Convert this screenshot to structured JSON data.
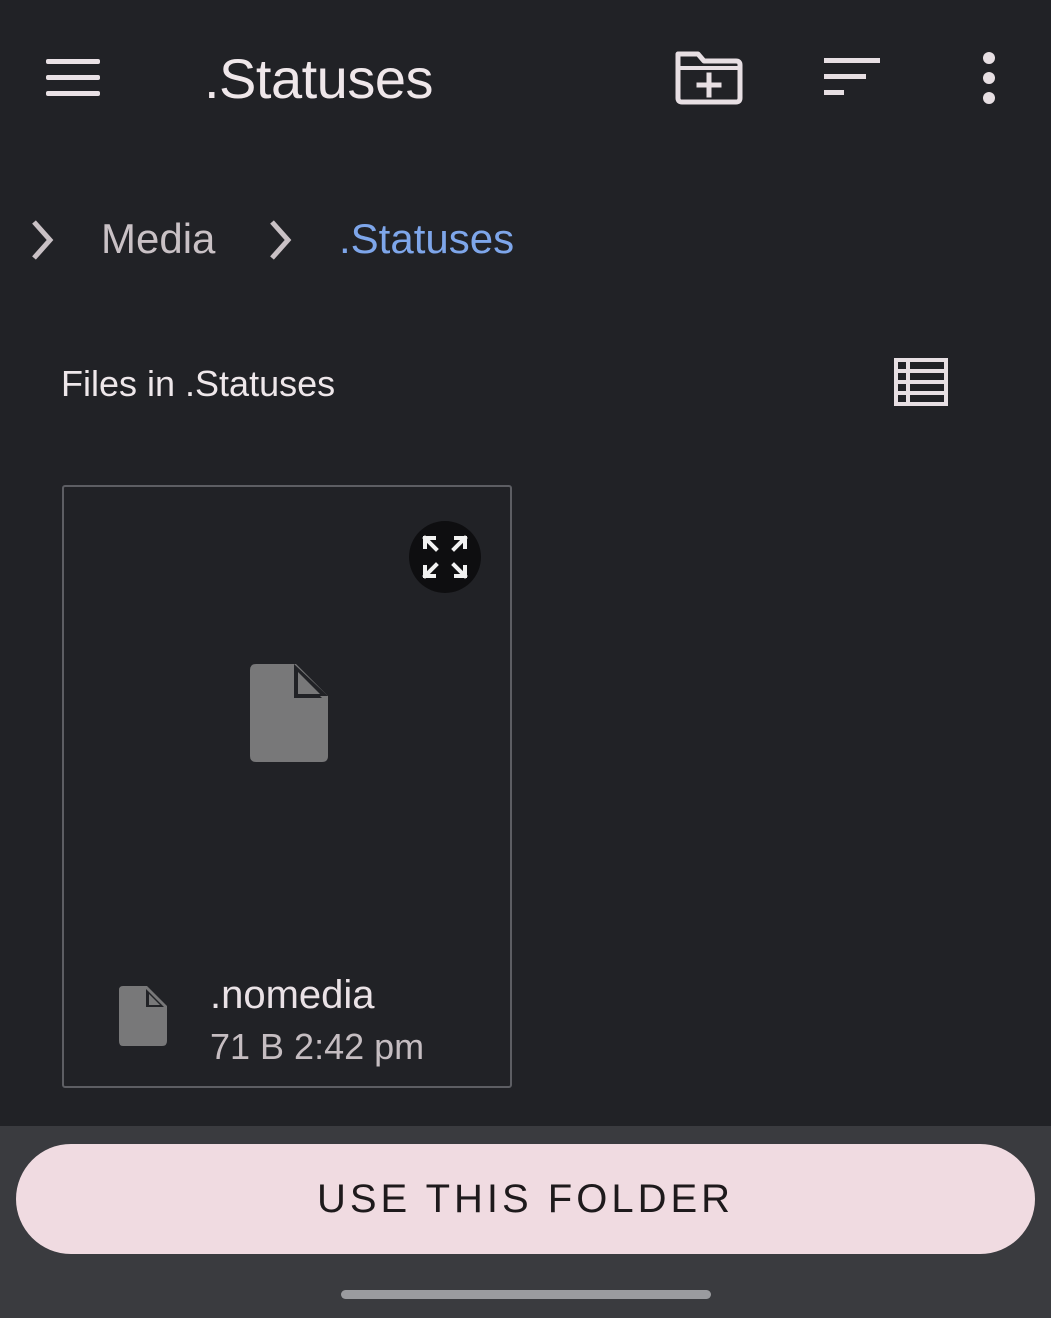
{
  "app_bar": {
    "title": ".Statuses",
    "menu_icon": "hamburger-menu-icon",
    "new_folder_icon": "create-new-folder-icon",
    "sort_icon": "sort-icon",
    "more_icon": "more-vertical-icon"
  },
  "breadcrumb": {
    "items": [
      {
        "label": "Media"
      },
      {
        "label": ".Statuses"
      }
    ],
    "separator_icon": "chevron-right-icon"
  },
  "section": {
    "title": "Files in .Statuses",
    "view_toggle_icon": "list-view-icon"
  },
  "files": [
    {
      "name": ".nomedia",
      "meta": "71 B 2:42 pm",
      "thumbnail_icon": "file-icon",
      "type_icon": "file-icon",
      "preview_icon": "expand-icon"
    }
  ],
  "actions": {
    "use_folder_label": "USE THIS FOLDER"
  },
  "colors": {
    "background": "#212226",
    "breadcrumb_current": "#7ea6ea",
    "primary_button": "#f0dbe1",
    "bottom_bar": "#3a3b3f"
  }
}
